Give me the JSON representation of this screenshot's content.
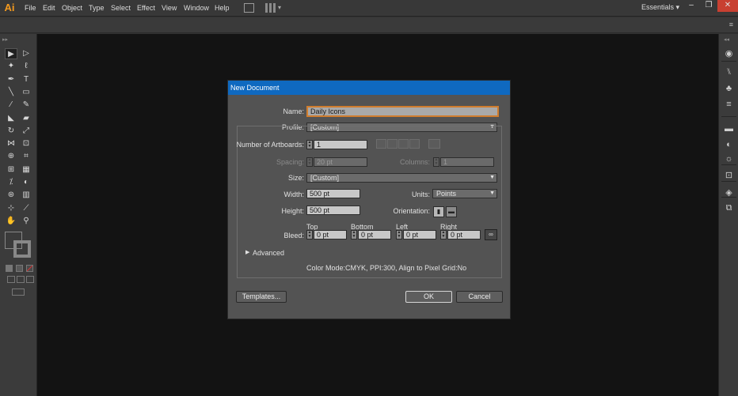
{
  "app": {
    "logo": "Ai",
    "menus": [
      "File",
      "Edit",
      "Object",
      "Type",
      "Select",
      "Effect",
      "View",
      "Window",
      "Help"
    ],
    "workspace": "Essentials",
    "window_buttons": {
      "minimize": "–",
      "restore": "❐",
      "close": "✕"
    }
  },
  "toolbar": {
    "tools": [
      {
        "name": "selection-tool-icon",
        "glyph": "▶"
      },
      {
        "name": "direct-selection-tool-icon",
        "glyph": "▷"
      },
      {
        "name": "magic-wand-tool-icon",
        "glyph": "✦"
      },
      {
        "name": "lasso-tool-icon",
        "glyph": "ℓ"
      },
      {
        "name": "pen-tool-icon",
        "glyph": "✒"
      },
      {
        "name": "type-tool-icon",
        "glyph": "T"
      },
      {
        "name": "line-tool-icon",
        "glyph": "╲"
      },
      {
        "name": "rectangle-tool-icon",
        "glyph": "▭"
      },
      {
        "name": "paintbrush-tool-icon",
        "glyph": "⁄"
      },
      {
        "name": "pencil-tool-icon",
        "glyph": "✎"
      },
      {
        "name": "blob-brush-tool-icon",
        "glyph": "◣"
      },
      {
        "name": "eraser-tool-icon",
        "glyph": "▰"
      },
      {
        "name": "rotate-tool-icon",
        "glyph": "↻"
      },
      {
        "name": "scale-tool-icon",
        "glyph": "⤢"
      },
      {
        "name": "width-tool-icon",
        "glyph": "⋈"
      },
      {
        "name": "free-transform-tool-icon",
        "glyph": "⊡"
      },
      {
        "name": "shape-builder-tool-icon",
        "glyph": "⊕"
      },
      {
        "name": "perspective-grid-tool-icon",
        "glyph": "⌗"
      },
      {
        "name": "mesh-tool-icon",
        "glyph": "⊞"
      },
      {
        "name": "gradient-tool-icon",
        "glyph": "▦"
      },
      {
        "name": "eyedropper-tool-icon",
        "glyph": "⁒"
      },
      {
        "name": "blend-tool-icon",
        "glyph": "◐"
      },
      {
        "name": "symbol-sprayer-tool-icon",
        "glyph": "⊛"
      },
      {
        "name": "column-graph-tool-icon",
        "glyph": "▥"
      },
      {
        "name": "artboard-tool-icon",
        "glyph": "⊹"
      },
      {
        "name": "slice-tool-icon",
        "glyph": "⟋"
      },
      {
        "name": "hand-tool-icon",
        "glyph": "✋"
      },
      {
        "name": "zoom-tool-icon",
        "glyph": "⚲"
      }
    ]
  },
  "right_panel": {
    "icons": [
      "color-guide-icon",
      "brushes-icon",
      "symbols-icon",
      "stroke-icon",
      "gradient-icon",
      "transparency-icon",
      "appearance-icon",
      "graphic-styles-icon",
      "layers-icon",
      "artboards-icon"
    ]
  },
  "dialog": {
    "title": "New Document",
    "name_label": "Name:",
    "name_value": "Daily Icons",
    "profile_label": "Profile:",
    "profile_value": "[Custom]",
    "artboards_label": "Number of Artboards:",
    "artboards_value": "1",
    "spacing_label": "Spacing:",
    "spacing_value": "20 pt",
    "columns_label": "Columns:",
    "columns_value": "1",
    "size_label": "Size:",
    "size_value": "[Custom]",
    "width_label": "Width:",
    "width_value": "500 pt",
    "units_label": "Units:",
    "units_value": "Points",
    "height_label": "Height:",
    "height_value": "500 pt",
    "orientation_label": "Orientation:",
    "bleed_label": "Bleed:",
    "bleed_top_label": "Top",
    "bleed_top_value": "0 pt",
    "bleed_bottom_label": "Bottom",
    "bleed_bottom_value": "0 pt",
    "bleed_left_label": "Left",
    "bleed_left_value": "0 pt",
    "bleed_right_label": "Right",
    "bleed_right_value": "0 pt",
    "advanced_label": "Advanced",
    "summary": "Color Mode:CMYK, PPI:300, Align to Pixel Grid:No",
    "templates_button": "Templates...",
    "ok_button": "OK",
    "cancel_button": "Cancel"
  }
}
